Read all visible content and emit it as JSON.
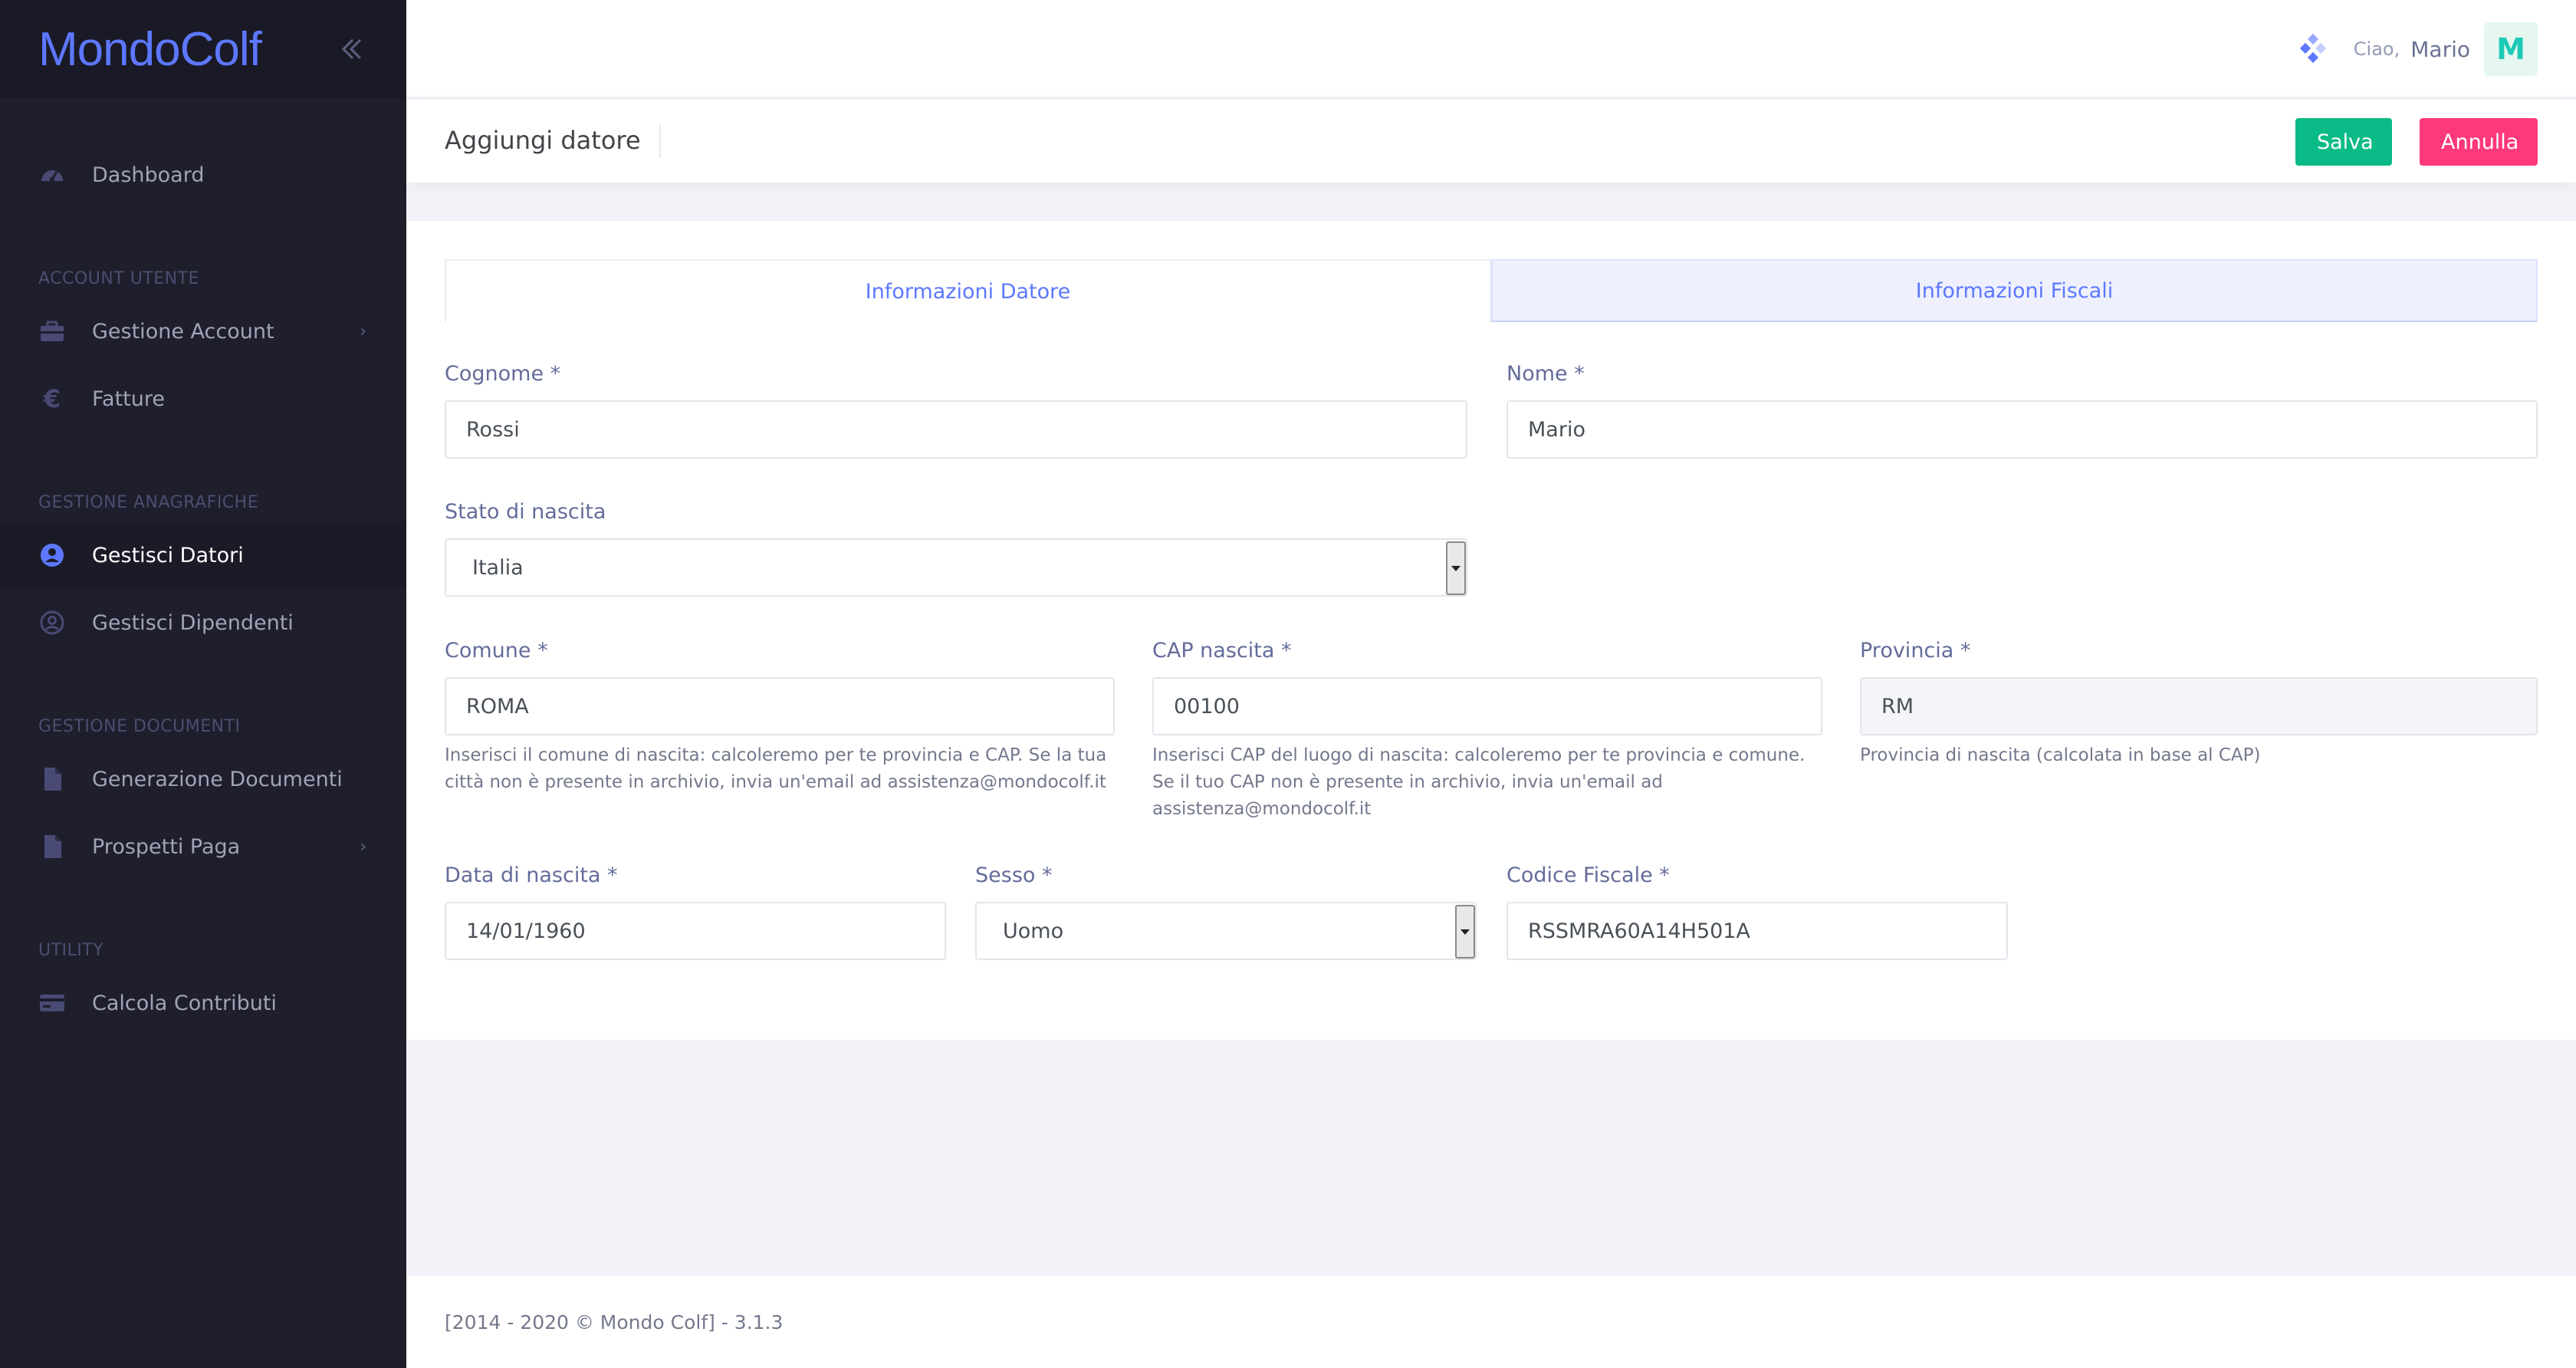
{
  "brand": {
    "logo": "MondoColf"
  },
  "sidebar": {
    "dashboard": "Dashboard",
    "section_account": "ACCOUNT UTENTE",
    "gestione_account": "Gestione Account",
    "fatture": "Fatture",
    "section_anagrafiche": "GESTIONE ANAGRAFICHE",
    "gestisci_datori": "Gestisci Datori",
    "gestisci_dipendenti": "Gestisci Dipendenti",
    "section_documenti": "GESTIONE DOCUMENTI",
    "generazione_documenti": "Generazione Documenti",
    "prospetti_paga": "Prospetti Paga",
    "section_utility": "UTILITY",
    "calcola_contributi": "Calcola Contributi"
  },
  "topbar": {
    "greeting": "Ciao,",
    "username": "Mario",
    "avatar_letter": "M"
  },
  "subheader": {
    "title": "Aggiungi datore",
    "save_label": "Salva",
    "cancel_label": "Annulla"
  },
  "tabs": {
    "datore": "Informazioni Datore",
    "fiscali": "Informazioni Fiscali"
  },
  "form": {
    "cognome_label": "Cognome *",
    "cognome_value": "Rossi",
    "nome_label": "Nome *",
    "nome_value": "Mario",
    "stato_label": "Stato di nascita",
    "stato_value": "Italia",
    "comune_label": "Comune *",
    "comune_value": "ROMA",
    "comune_help": "Inserisci il comune di nascita: calcoleremo per te provincia e CAP. Se la tua città non è presente in archivio, invia un'email ad assistenza@mondocolf.it",
    "cap_label": "CAP nascita *",
    "cap_value": "00100",
    "cap_help": "Inserisci CAP del luogo di nascita: calcoleremo per te provincia e comune. Se il tuo CAP non è presente in archivio, invia un'email ad assistenza@mondocolf.it",
    "provincia_label": "Provincia *",
    "provincia_value": "RM",
    "provincia_help": "Provincia di nascita (calcolata in base al CAP)",
    "data_label": "Data di nascita *",
    "data_value": "14/01/1960",
    "sesso_label": "Sesso *",
    "sesso_value": "Uomo",
    "cf_label": "Codice Fiscale *",
    "cf_value": "RSSMRA60A14H501A"
  },
  "footer": {
    "text": "[2014 - 2020 © Mondo Colf] - 3.1.3"
  },
  "colors": {
    "sidebar_bg": "#1e1e2d",
    "accent": "#5d78ff",
    "save": "#0abb87",
    "cancel": "#fd397a"
  }
}
